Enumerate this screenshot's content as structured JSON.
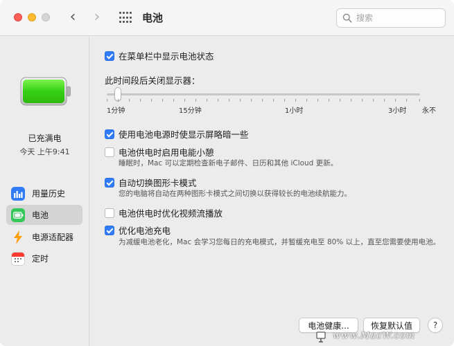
{
  "window": {
    "title": "电池",
    "search_placeholder": "搜索"
  },
  "sidebar": {
    "status": "已充满电",
    "status_time": "今天 上午9:41",
    "items": [
      {
        "label": "用量历史",
        "icon": "bar-chart-icon",
        "color": "#2f7cf6"
      },
      {
        "label": "电池",
        "icon": "battery-icon",
        "color": "#34c759"
      },
      {
        "label": "电源适配器",
        "icon": "lightning-icon",
        "color": "#ff9f0a"
      },
      {
        "label": "定时",
        "icon": "calendar-icon",
        "color": "#ff3b30"
      }
    ]
  },
  "main": {
    "show_in_menubar": {
      "label": "在菜单栏中显示电池状态",
      "checked": true
    },
    "slider": {
      "title": "此时间段后关闭显示器：",
      "value_label": "1分钟",
      "ticks": [
        "1分钟",
        "15分钟",
        "1小时",
        "3小时",
        "永不"
      ]
    },
    "options": [
      {
        "label": "使用电池电源时使显示屏略暗一些",
        "checked": true,
        "desc": ""
      },
      {
        "label": "电池供电时启用电能小憩",
        "checked": false,
        "desc": "睡眠时，Mac 可以定期检查新电子邮件、日历和其他 iCloud 更新。"
      },
      {
        "label": "自动切换图形卡模式",
        "checked": true,
        "desc": "您的电脑将自动在两种图形卡模式之间切换以获得较长的电池续航能力。"
      },
      {
        "label": "电池供电时优化视频流播放",
        "checked": false,
        "desc": ""
      },
      {
        "label": "优化电池充电",
        "checked": true,
        "desc": "为减缓电池老化，Mac 会学习您每日的充电模式，并暂缓充电至 80% 以上，直至您需要使用电池。"
      }
    ],
    "buttons": {
      "battery_health": "电池健康...",
      "restore_defaults": "恢复默认值",
      "help": "?"
    }
  },
  "watermark": "www.MacW.com",
  "colors": {
    "accent": "#2f7cf6",
    "battery_green": "#34c759"
  }
}
